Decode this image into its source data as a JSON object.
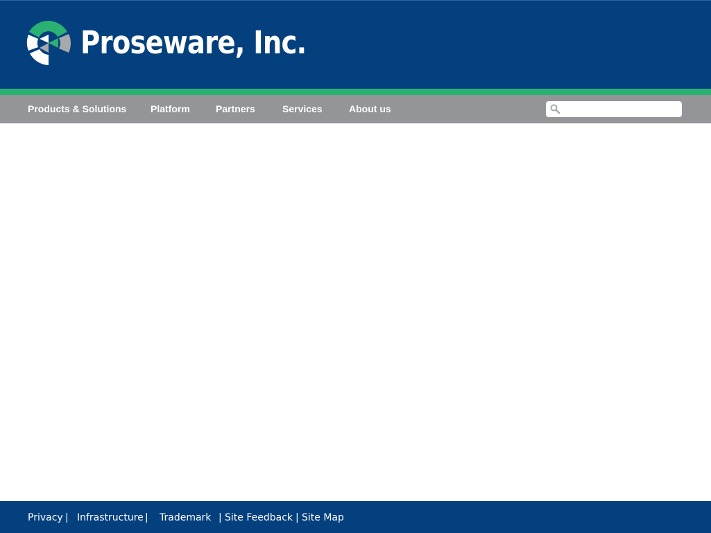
{
  "brand": {
    "name": "Proseware, Inc."
  },
  "nav": {
    "items": [
      {
        "label": "Products & Solutions"
      },
      {
        "label": "Platform"
      },
      {
        "label": "Partners"
      },
      {
        "label": "Services"
      },
      {
        "label": "About us"
      }
    ]
  },
  "search": {
    "value": "",
    "placeholder": "",
    "icon": "search-icon"
  },
  "footer": {
    "links": [
      {
        "label": "Privacy"
      },
      {
        "label": "Infrastructure"
      },
      {
        "label": "Trademark"
      },
      {
        "label": "Site Feedback"
      },
      {
        "label": "Site Map"
      }
    ],
    "separator": "|"
  },
  "colors": {
    "header_bg": "#04407d",
    "accent_green": "#2bb273",
    "nav_bg": "#939598",
    "logo_gray": "#a7a9ac"
  }
}
